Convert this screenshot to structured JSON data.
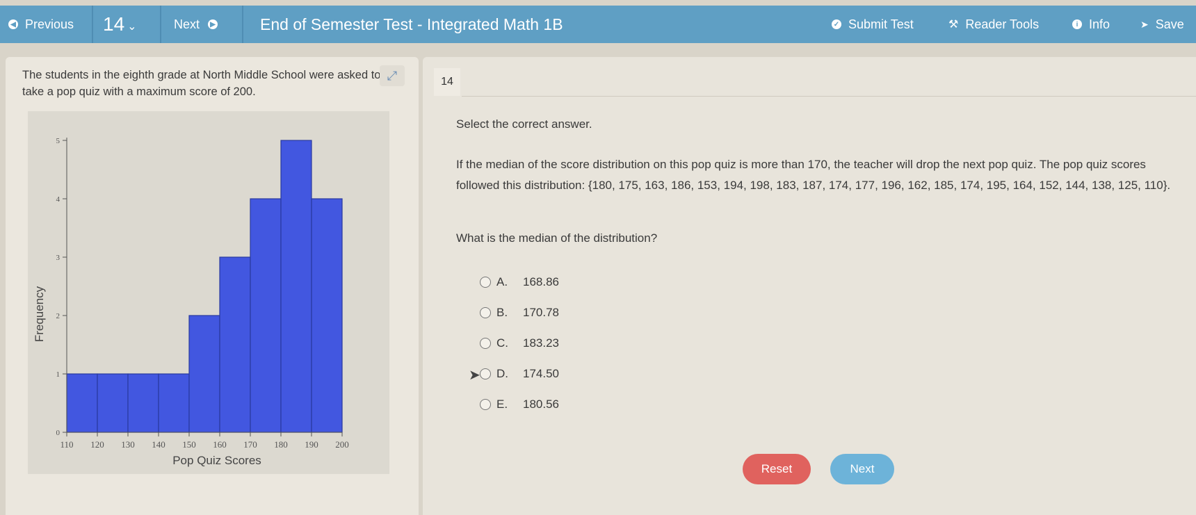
{
  "topbar": {
    "previous_label": "Previous",
    "question_number": "14",
    "next_label": "Next",
    "title": "End of Semester Test - Integrated Math 1B",
    "submit_label": "Submit Test",
    "reader_tools_label": "Reader Tools",
    "info_label": "Info",
    "save_label": "Save"
  },
  "passage": {
    "text": "The students in the eighth grade at North Middle School were asked to take a pop quiz with a maximum score of 200."
  },
  "question": {
    "number": "14",
    "instruction": "Select the correct answer.",
    "body": "If the median of the score distribution on this pop quiz is more than 170, the teacher will drop the next pop quiz. The pop quiz scores followed this distribution: {180, 175, 163, 186, 153, 194, 198, 183, 187, 174, 177, 196, 162, 185, 174, 195, 164, 152, 144, 138, 125, 110}.",
    "prompt": "What is the median of the distribution?",
    "choices": [
      {
        "letter": "A.",
        "value": "168.86"
      },
      {
        "letter": "B.",
        "value": "170.78"
      },
      {
        "letter": "C.",
        "value": "183.23"
      },
      {
        "letter": "D.",
        "value": "174.50"
      },
      {
        "letter": "E.",
        "value": "180.56"
      }
    ],
    "reset_label": "Reset",
    "next_label": "Next"
  },
  "colors": {
    "topbar": "#5f9fc4",
    "bar_fill": "#4257e0",
    "reset": "#e0625e",
    "next": "#6db3d9"
  },
  "chart_data": {
    "type": "bar",
    "title": "",
    "xlabel": "Pop Quiz Scores",
    "ylabel": "Frequency",
    "bins": [
      [
        110,
        120
      ],
      [
        120,
        130
      ],
      [
        130,
        140
      ],
      [
        140,
        150
      ],
      [
        150,
        160
      ],
      [
        160,
        170
      ],
      [
        170,
        180
      ],
      [
        180,
        190
      ],
      [
        190,
        200
      ]
    ],
    "values": [
      1,
      1,
      1,
      1,
      2,
      3,
      4,
      5,
      4
    ],
    "x_ticks": [
      110,
      120,
      130,
      140,
      150,
      160,
      170,
      180,
      190,
      200
    ],
    "y_ticks": [
      0,
      1,
      2,
      3,
      4,
      5
    ],
    "xlim": [
      110,
      200
    ],
    "ylim": [
      0,
      5
    ],
    "grid": false
  }
}
